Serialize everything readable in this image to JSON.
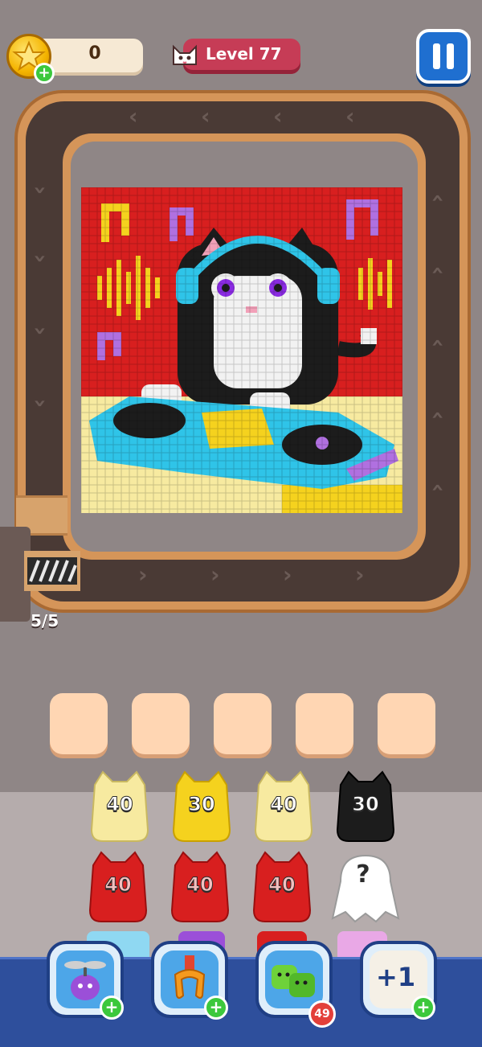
{
  "hud": {
    "coins": "0",
    "level": "Level 77",
    "coin_icon": "gold-star-coin",
    "level_icon": "cat-face"
  },
  "board": {
    "capacity": "5/5",
    "art": "pixel-cat-dj",
    "colors": {
      "red": "#d81f1f",
      "yellow": "#f5d21e",
      "cream": "#f7eaa0",
      "black": "#1c1c1c",
      "cyan": "#2fc4e8",
      "purple": "#b070e0",
      "white": "#f2f2f2"
    }
  },
  "queue_slots": 5,
  "shooters": [
    {
      "count": "40",
      "color": "#f7eaa0"
    },
    {
      "count": "30",
      "color": "#f5d21e"
    },
    {
      "count": "40",
      "color": "#f7eaa0"
    },
    {
      "count": "30",
      "color": "#1c1c1c"
    },
    {
      "count": "40",
      "color": "#d81f1f"
    },
    {
      "count": "40",
      "color": "#d81f1f"
    },
    {
      "count": "40",
      "color": "#d81f1f"
    },
    {
      "count": "?",
      "color": "#ffffff"
    }
  ],
  "boosters": [
    {
      "name": "propeller-booster",
      "icon": "purple-fan-creature"
    },
    {
      "name": "claw-booster",
      "icon": "orange-claw"
    },
    {
      "name": "jelly-booster",
      "icon": "green-jelly",
      "count": "49"
    },
    {
      "name": "plus-one-booster",
      "icon": "plus-one",
      "label": "+1"
    }
  ]
}
